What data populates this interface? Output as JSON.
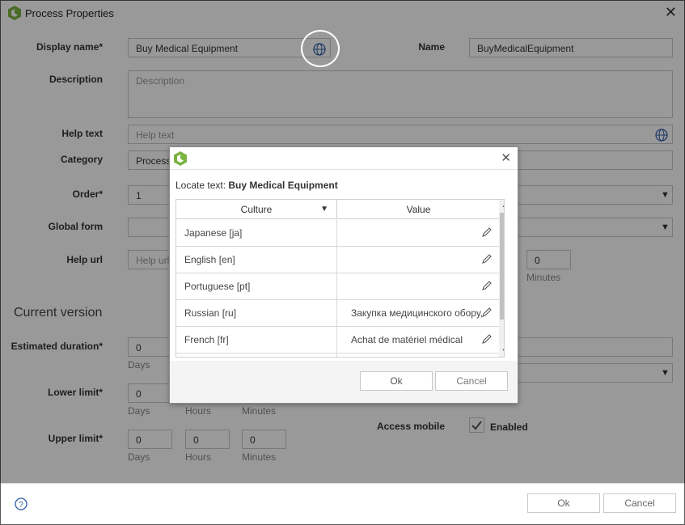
{
  "window": {
    "title": "Process Properties"
  },
  "form": {
    "display_name": {
      "label": "Display name*",
      "value": "Buy Medical Equipment"
    },
    "name": {
      "label": "Name",
      "value": "BuyMedicalEquipment"
    },
    "description": {
      "label": "Description",
      "placeholder": "Description"
    },
    "help_text": {
      "label": "Help text",
      "placeholder": "Help text"
    },
    "category": {
      "label": "Category",
      "value": "Process"
    },
    "order": {
      "label": "Order*",
      "value": "1"
    },
    "global_form": {
      "label": "Global form",
      "value": ""
    },
    "help_url": {
      "label": "Help url",
      "placeholder": "Help url"
    },
    "help_url_minutes": {
      "value": "0",
      "unit": "Minutes"
    }
  },
  "current_version": {
    "title": "Current version",
    "estimated_duration": {
      "label": "Estimated duration*",
      "days": "0",
      "days_label": "Days"
    },
    "lower_limit": {
      "label": "Lower limit*",
      "days": "0",
      "days_label": "Days",
      "hours_label": "Hours",
      "minutes_label": "Minutes"
    },
    "upper_limit": {
      "label": "Upper limit*",
      "days": "0",
      "hours": "0",
      "minutes": "0",
      "days_label": "Days",
      "hours_label": "Hours",
      "minutes_label": "Minutes"
    },
    "access_mobile": {
      "label": "Access mobile",
      "checkbox_label": "Enabled",
      "checked": true
    }
  },
  "footer": {
    "ok": "Ok",
    "cancel": "Cancel"
  },
  "dialog": {
    "locate_prefix": "Locate text: ",
    "locate_value": "Buy Medical Equipment",
    "columns": {
      "culture": "Culture",
      "value": "Value"
    },
    "rows": [
      {
        "culture": "Japanese [ja]",
        "value": ""
      },
      {
        "culture": "English [en]",
        "value": ""
      },
      {
        "culture": "Portuguese [pt]",
        "value": ""
      },
      {
        "culture": "Russian [ru]",
        "value": "Закупка медицинского обору,"
      },
      {
        "culture": "French [fr]",
        "value": "Achat de matériel médical"
      }
    ],
    "ok": "Ok",
    "cancel": "Cancel"
  },
  "colors": {
    "brand_green": "#7cb342",
    "overlay": "rgba(0,0,0,0.40)"
  }
}
